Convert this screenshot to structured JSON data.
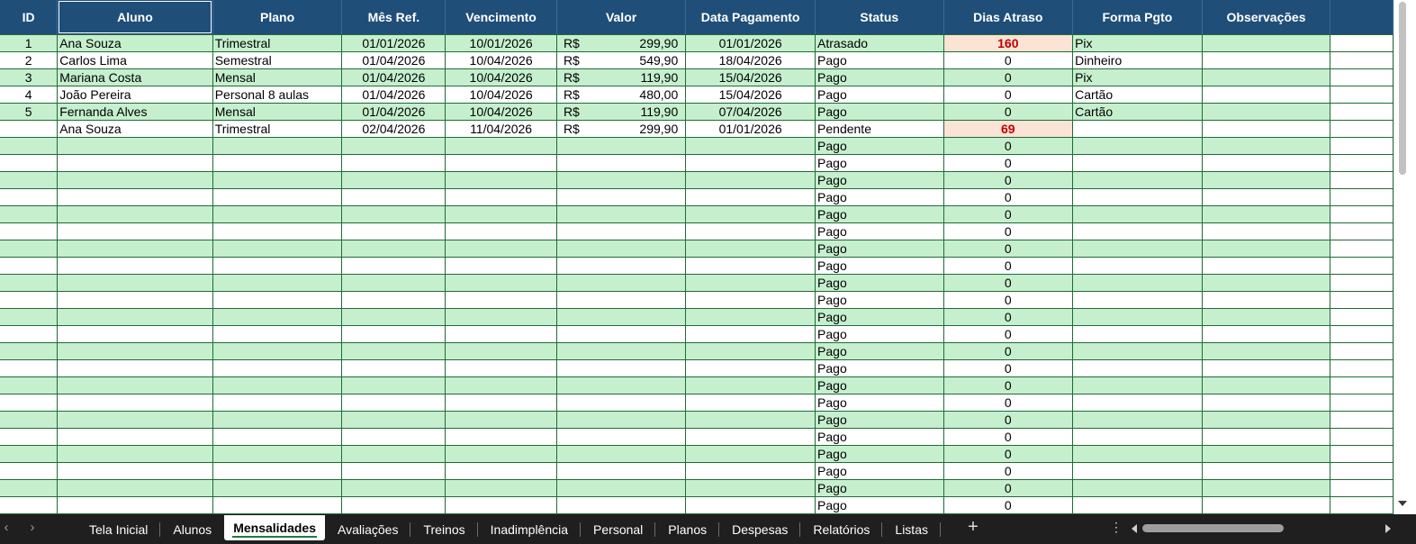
{
  "headers": [
    "ID",
    "Aluno",
    "Plano",
    "Mês Ref.",
    "Vencimento",
    "Valor",
    "Data Pagamento",
    "Status",
    "Dias Atraso",
    "Forma Pgto",
    "Observações"
  ],
  "currency_symbol": "R$",
  "data_rows": [
    {
      "id": "1",
      "aluno": "Ana Souza",
      "plano": "Trimestral",
      "mes_ref": "01/01/2026",
      "vencimento": "10/01/2026",
      "valor": "299,90",
      "data_pagamento": "01/01/2026",
      "status": "Atrasado",
      "dias_atraso": "160",
      "atraso_highlight": true,
      "forma_pgto": "Pix",
      "observacoes": ""
    },
    {
      "id": "2",
      "aluno": "Carlos Lima",
      "plano": "Semestral",
      "mes_ref": "01/04/2026",
      "vencimento": "10/04/2026",
      "valor": "549,90",
      "data_pagamento": "18/04/2026",
      "status": "Pago",
      "dias_atraso": "0",
      "atraso_highlight": false,
      "forma_pgto": "Dinheiro",
      "observacoes": ""
    },
    {
      "id": "3",
      "aluno": "Mariana Costa",
      "plano": "Mensal",
      "mes_ref": "01/04/2026",
      "vencimento": "10/04/2026",
      "valor": "119,90",
      "data_pagamento": "15/04/2026",
      "status": "Pago",
      "dias_atraso": "0",
      "atraso_highlight": false,
      "forma_pgto": "Pix",
      "observacoes": ""
    },
    {
      "id": "4",
      "aluno": "João Pereira",
      "plano": "Personal 8 aulas",
      "mes_ref": "01/04/2026",
      "vencimento": "10/04/2026",
      "valor": "480,00",
      "data_pagamento": "15/04/2026",
      "status": "Pago",
      "dias_atraso": "0",
      "atraso_highlight": false,
      "forma_pgto": "Cartão",
      "observacoes": ""
    },
    {
      "id": "5",
      "aluno": "Fernanda Alves",
      "plano": "Mensal",
      "mes_ref": "01/04/2026",
      "vencimento": "10/04/2026",
      "valor": "119,90",
      "data_pagamento": "07/04/2026",
      "status": "Pago",
      "dias_atraso": "0",
      "atraso_highlight": false,
      "forma_pgto": "Cartão",
      "observacoes": ""
    },
    {
      "id": "",
      "aluno": "Ana Souza",
      "plano": "Trimestral",
      "mes_ref": "02/04/2026",
      "vencimento": "11/04/2026",
      "valor": "299,90",
      "data_pagamento": "01/01/2026",
      "status": "Pendente",
      "dias_atraso": "69",
      "atraso_highlight": true,
      "forma_pgto": "",
      "observacoes": ""
    }
  ],
  "empty_rows": {
    "count": 22,
    "status": "Pago",
    "dias_atraso": "0"
  },
  "sheet_tabs": [
    "Tela Inicial",
    "Alunos",
    "Mensalidades",
    "Avaliações",
    "Treinos",
    "Inadimplência",
    "Personal",
    "Planos",
    "Despesas",
    "Relatórios",
    "Listas"
  ],
  "active_tab": "Mensalidades",
  "icons": {
    "prev_sheet": "chevron-left-icon",
    "next_sheet": "chevron-right-icon",
    "add_sheet": "plus-icon",
    "more": "vertical-dots-icon"
  },
  "colors": {
    "header_bg": "#1f4e79",
    "band_green": "#c6efce",
    "late_bg": "#fbe3d6",
    "late_text": "#c00000",
    "border_green": "#1e6b36"
  }
}
